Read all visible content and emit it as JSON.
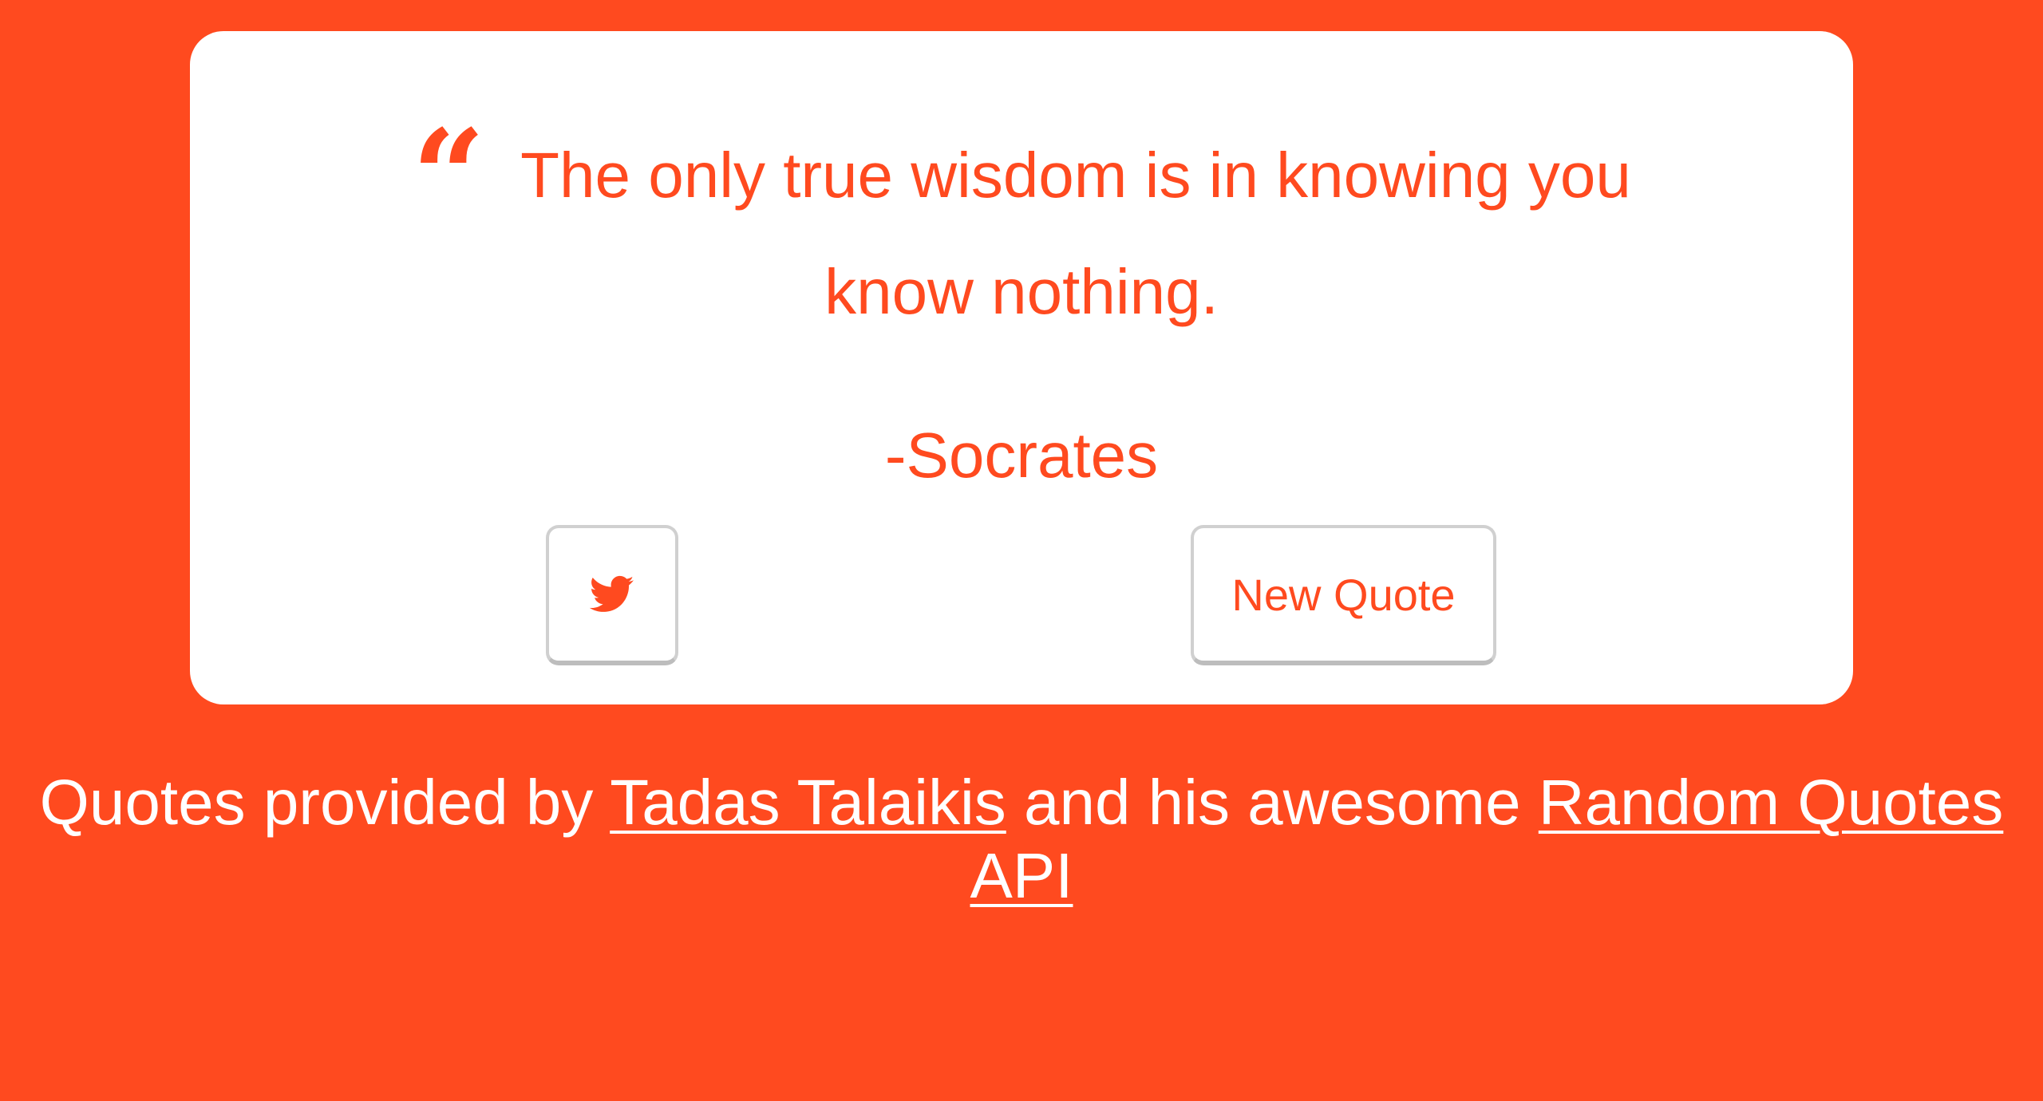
{
  "theme": {
    "accent": "#ff4a1f",
    "card_background": "#ffffff",
    "button_border": "#d0d0d0"
  },
  "quote": {
    "mark": "“",
    "text": "The only true wisdom is in knowing you know nothing.",
    "author": "-Socrates"
  },
  "buttons": {
    "tweet_icon": "twitter-icon",
    "new_quote_label": "New Quote"
  },
  "credits": {
    "prefix": "Quotes provided by ",
    "author_link": "Tadas Talaikis",
    "middle": " and his awesome ",
    "api_link": "Random Quotes API"
  }
}
